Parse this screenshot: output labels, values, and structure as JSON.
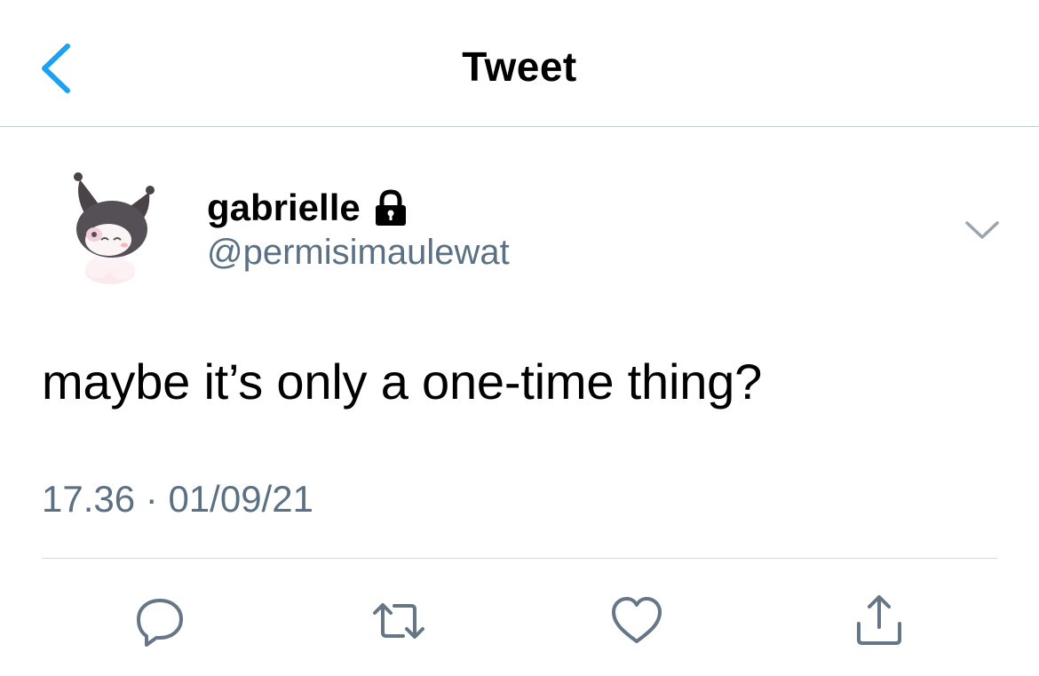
{
  "header": {
    "title": "Tweet",
    "back_icon": "chevron-left-icon",
    "accent_color": "#1da1f2"
  },
  "author": {
    "display_name": "gabrielle",
    "handle": "@permisimaulewat",
    "protected_icon": "lock-icon",
    "avatar_icon": "kuromi-avatar",
    "more_icon": "chevron-down-icon"
  },
  "tweet": {
    "text": "maybe it’s only a one-time thing?",
    "time": "17.36",
    "separator": "·",
    "date": "01/09/21"
  },
  "actions": [
    {
      "icon": "reply-icon"
    },
    {
      "icon": "retweet-icon"
    },
    {
      "icon": "like-icon"
    },
    {
      "icon": "share-icon"
    }
  ],
  "colors": {
    "text": "#000000",
    "secondary_text": "#5b7083",
    "divider": "#d6dadf",
    "icon": "#657786"
  }
}
